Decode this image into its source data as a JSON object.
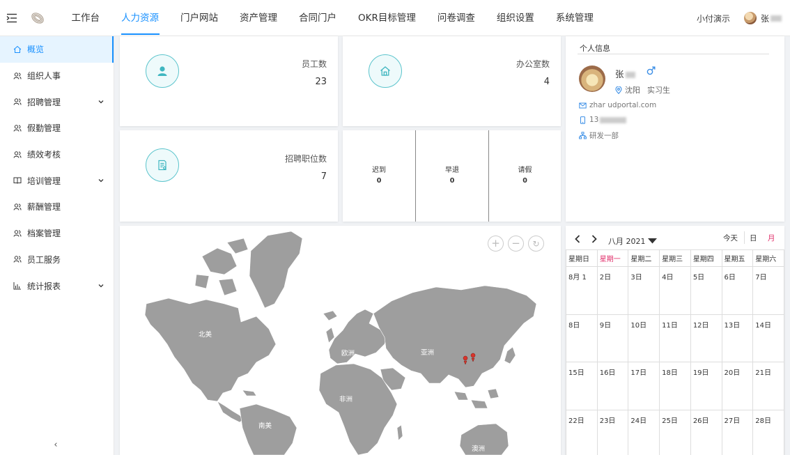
{
  "topbar": {
    "menu_icon": "indent-menu-icon",
    "logo_icon": "company-logo",
    "nav": [
      {
        "label": "工作台"
      },
      {
        "label": "人力资源",
        "active": true
      },
      {
        "label": "门户网站"
      },
      {
        "label": "资产管理"
      },
      {
        "label": "合同门户"
      },
      {
        "label": "OKR目标管理"
      },
      {
        "label": "问卷调查"
      },
      {
        "label": "组织设置"
      },
      {
        "label": "系统管理"
      }
    ],
    "demo_label": "小付演示",
    "user_name": "张"
  },
  "sidebar": {
    "items": [
      {
        "label": "概览",
        "icon": "home-icon",
        "active": true
      },
      {
        "label": "组织人事",
        "icon": "users-icon"
      },
      {
        "label": "招聘管理",
        "icon": "users-icon",
        "expandable": true
      },
      {
        "label": "假勤管理",
        "icon": "users-icon"
      },
      {
        "label": "绩效考核",
        "icon": "users-icon"
      },
      {
        "label": "培训管理",
        "icon": "book-icon",
        "expandable": true
      },
      {
        "label": "薪酬管理",
        "icon": "users-icon"
      },
      {
        "label": "档案管理",
        "icon": "users-icon"
      },
      {
        "label": "员工服务",
        "icon": "users-icon"
      },
      {
        "label": "统计报表",
        "icon": "bar-chart-icon",
        "expandable": true
      }
    ],
    "collapse_glyph": "‹"
  },
  "stats": {
    "employees": {
      "label": "员工数",
      "value": "23",
      "icon": "user-icon"
    },
    "offices": {
      "label": "办公室数",
      "value": "4",
      "icon": "home-icon"
    },
    "positions": {
      "label": "招聘职位数",
      "value": "7",
      "icon": "document-icon"
    }
  },
  "attendance": [
    {
      "label": "迟到",
      "value": "0"
    },
    {
      "label": "早退",
      "value": "0"
    },
    {
      "label": "请假",
      "value": "0"
    }
  ],
  "profile": {
    "title": "个人信息",
    "name": "张",
    "gender_icon": "male-icon",
    "city": "沈阳",
    "role": "实习生",
    "email": "zhar            udportal.com",
    "phone": "13",
    "department": "研发一部"
  },
  "map": {
    "controls": [
      "+",
      "−",
      "↻"
    ],
    "regions": [
      "北美",
      "欧洲",
      "亚洲",
      "非洲",
      "南美",
      "澳洲"
    ],
    "marker_color": "#d9342b"
  },
  "calendar": {
    "month_title": "八月 2021",
    "today_label": "今天",
    "day_view": "日",
    "month_view": "月",
    "weekdays": [
      "星期日",
      "星期一",
      "星期二",
      "星期三",
      "星期四",
      "星期五",
      "星期六"
    ],
    "highlight_weekday_index": 1,
    "weeks": [
      [
        "8月 1",
        "2日",
        "3日",
        "4日",
        "5日",
        "6日",
        "7日"
      ],
      [
        "8日",
        "9日",
        "10日",
        "11日",
        "12日",
        "13日",
        "14日"
      ],
      [
        "15日",
        "16日",
        "17日",
        "18日",
        "19日",
        "20日",
        "21日"
      ],
      [
        "22日",
        "23日",
        "24日",
        "25日",
        "26日",
        "27日",
        "28日"
      ]
    ]
  },
  "colors": {
    "accent": "#1890ff",
    "teal": "#3fb6c0",
    "calendar_highlight": "#e0306b"
  }
}
